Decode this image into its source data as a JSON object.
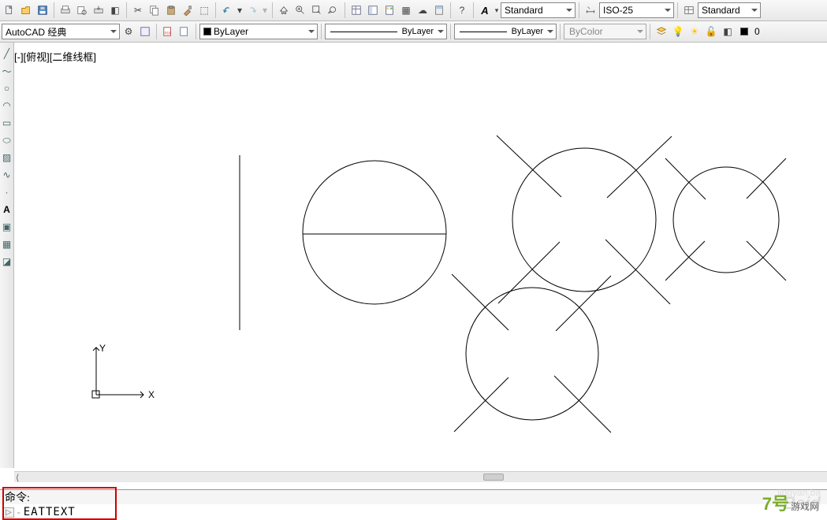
{
  "toolbar1": {
    "text_style": "Standard",
    "dim_style": "ISO-25",
    "table_style": "Standard"
  },
  "toolbar2": {
    "workspace": "AutoCAD 经典",
    "layer_name": "ByLayer",
    "linetype": "ByLayer",
    "lineweight": "ByLayer",
    "plot_style": "ByColor",
    "layer_index": "0"
  },
  "viewport": {
    "label": "[-][俯视][二维线框]",
    "ucs_y": "Y",
    "ucs_x": "X"
  },
  "command": {
    "history_label": "命令:",
    "prompt_icon": "▷",
    "input_value": "EATTEXT"
  },
  "watermark": {
    "main": "Baid",
    "sub": "jingyan.ba",
    "logo": "7号",
    "logo_sub": "游戏网"
  }
}
